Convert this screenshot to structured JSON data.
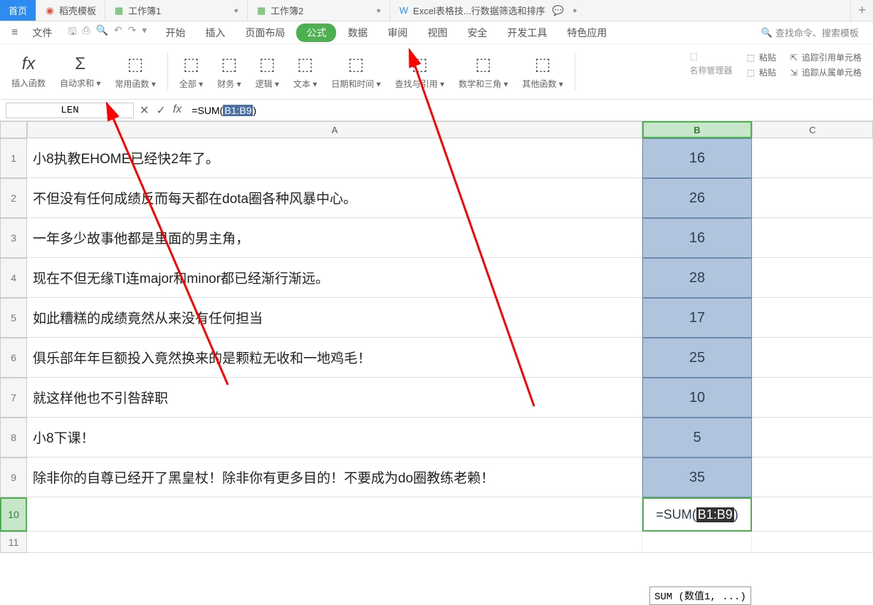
{
  "tabs": {
    "home": "首页",
    "template": "稻壳模板",
    "wb1": "工作簿1",
    "wb2": "工作簿2",
    "excel_tips": "Excel表格技...行数据筛选和排序"
  },
  "menu": {
    "file": "文件",
    "start": "开始",
    "insert": "插入",
    "page_layout": "页面布局",
    "formula": "公式",
    "data": "数据",
    "review": "审阅",
    "view": "视图",
    "security": "安全",
    "dev_tools": "开发工具",
    "special": "特色应用",
    "search_placeholder": "查找命令、搜索模板"
  },
  "ribbon": {
    "insert_fn": "插入函数",
    "auto_sum": "自动求和",
    "common_fn": "常用函数",
    "all": "全部",
    "finance": "财务",
    "logic": "逻辑",
    "text": "文本",
    "datetime": "日期和时间",
    "lookup": "查找与引用",
    "math": "数学和三角",
    "other_fn": "其他函数",
    "name_mgr": "名称管理器",
    "pin": "粘贴",
    "trace_prec": "追踪引用单元格",
    "trace_dep": "追踪从属单元格"
  },
  "formula_bar": {
    "name_box": "LEN",
    "formula_prefix": "=SUM(",
    "formula_sel": "B1:B9",
    "formula_suffix": ")"
  },
  "columns": {
    "A": "A",
    "B": "B",
    "C": "C"
  },
  "rows": [
    {
      "n": "1",
      "A": "小8执教EHOME已经快2年了。",
      "B": "16"
    },
    {
      "n": "2",
      "A": "不但没有任何成绩反而每天都在dota圈各种风暴中心。",
      "B": "26"
    },
    {
      "n": "3",
      "A": "一年多少故事他都是里面的男主角，",
      "B": "16"
    },
    {
      "n": "4",
      "A": "现在不但无缘TI连major和minor都已经渐行渐远。",
      "B": "28"
    },
    {
      "n": "5",
      "A": "如此糟糕的成绩竟然从来没有任何担当",
      "B": "17"
    },
    {
      "n": "6",
      "A": "俱乐部年年巨额投入竟然换来的是颗粒无收和一地鸡毛！",
      "B": "25"
    },
    {
      "n": "7",
      "A": "就这样他也不引咎辞职",
      "B": "10"
    },
    {
      "n": "8",
      "A": "小8下课！",
      "B": "5"
    },
    {
      "n": "9",
      "A": "除非你的自尊已经开了黑皇杖！除非你有更多目的！不要成为do圈教练老赖！",
      "B": "35"
    }
  ],
  "active_cell": {
    "prefix": "=SUM(",
    "sel": "B1:B9",
    "suffix": ")"
  },
  "hint": "SUM (数值1, ...)",
  "row10": "10",
  "row11": "11"
}
